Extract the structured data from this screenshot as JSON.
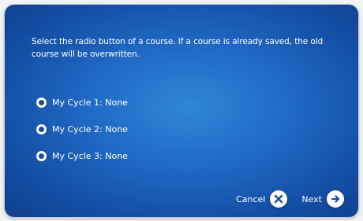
{
  "dialog": {
    "instructions": "Select the radio button of a course. If a course is already saved, the old course will be overwritten.",
    "options": [
      {
        "label": "My Cycle 1: None",
        "selected": false
      },
      {
        "label": "My Cycle 2: None",
        "selected": false
      },
      {
        "label": "My Cycle 3: None",
        "selected": false
      }
    ],
    "cancel_label": "Cancel",
    "next_label": "Next",
    "cancel_icon": "close-icon",
    "next_icon": "arrow-right-icon"
  },
  "colors": {
    "panel_blue": "#1f67c2",
    "icon_blue": "#1a4f9d",
    "text": "#ffffff"
  }
}
